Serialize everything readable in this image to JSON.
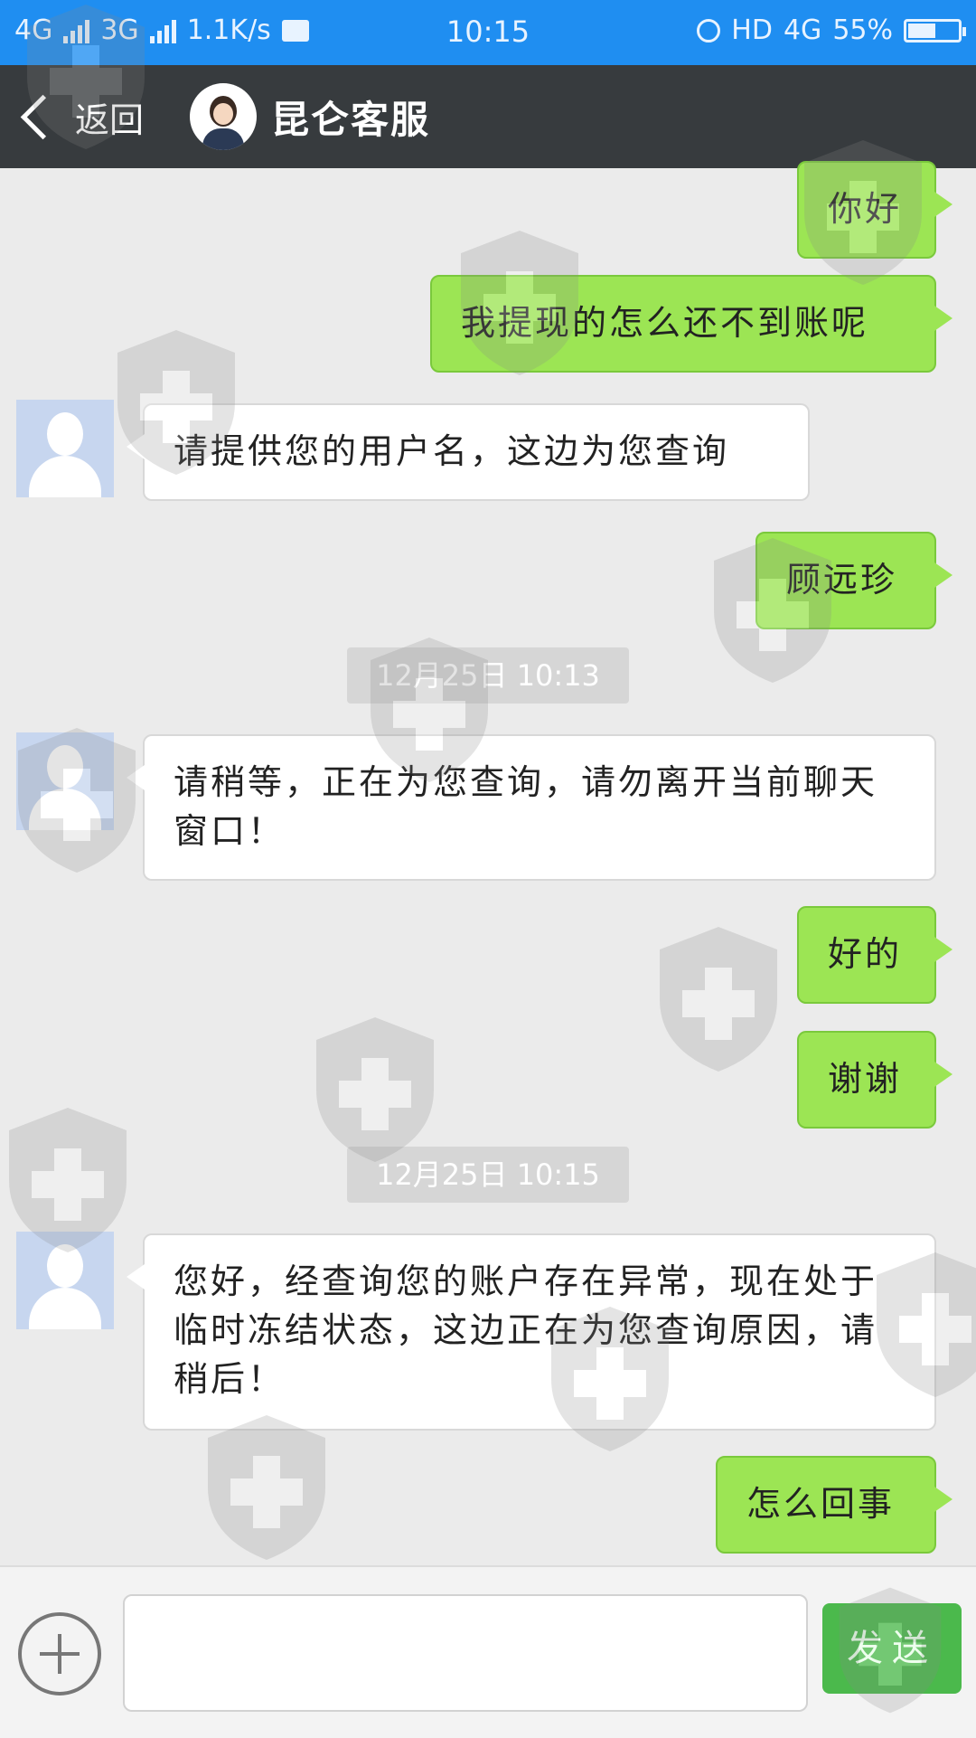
{
  "status_bar": {
    "network_1": "4G",
    "network_2": "3G",
    "speed": "1.1K/s",
    "time": "10:15",
    "hd": "HD",
    "network_3": "4G",
    "battery_level": 0.55,
    "battery_text": "55%"
  },
  "header": {
    "back_label": "返回",
    "contact_name": "昆仑客服"
  },
  "messages": [
    {
      "dir": "out",
      "text": "你好"
    },
    {
      "dir": "out",
      "text": "我提现的怎么还不到账呢"
    },
    {
      "dir": "in",
      "text": "请提供您的用户名，这边为您查询"
    },
    {
      "dir": "out",
      "text": "顾远珍"
    },
    {
      "dir": "time",
      "text": "12月25日 10:13"
    },
    {
      "dir": "in",
      "text": "请稍等，正在为您查询，请勿离开当前聊天窗口！"
    },
    {
      "dir": "out",
      "text": "好的"
    },
    {
      "dir": "out",
      "text": "谢谢"
    },
    {
      "dir": "time",
      "text": "12月25日 10:15"
    },
    {
      "dir": "in",
      "text": "您好，经查询您的账户存在异常，现在处于临时冻结状态，这边正在为您查询原因，请稍后！"
    },
    {
      "dir": "out",
      "text": "怎么回事"
    }
  ],
  "input_bar": {
    "placeholder": "",
    "send_label": "发送"
  },
  "colors": {
    "status_bar": "#1f8ef1",
    "header": "#373b3e",
    "bubble_out": "#9ce554",
    "bubble_in": "#ffffff",
    "send_button": "#4bb94c"
  }
}
